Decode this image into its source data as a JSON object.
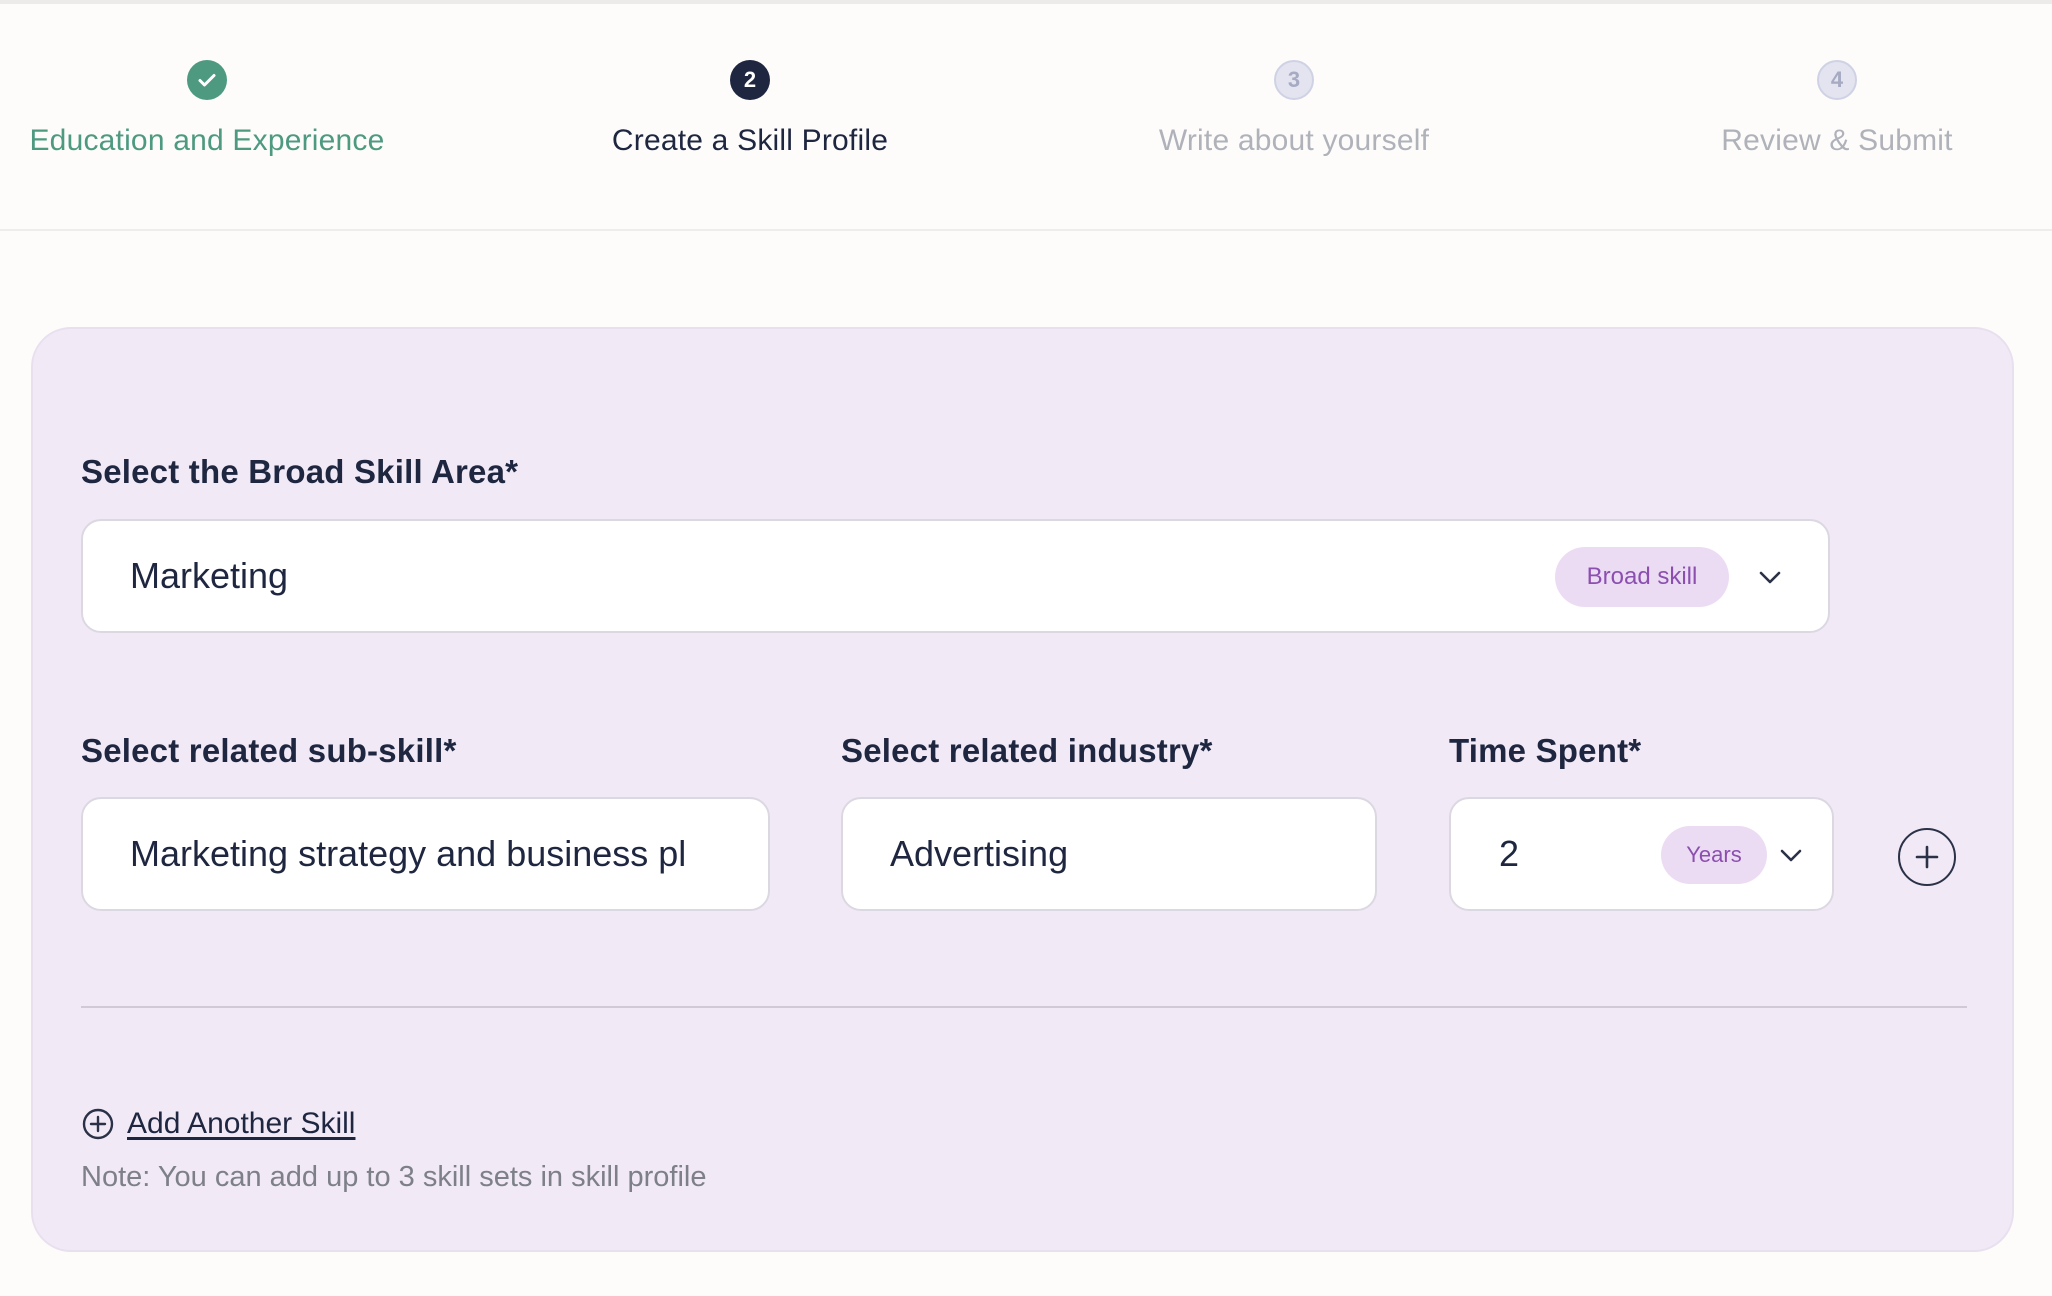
{
  "stepper": {
    "steps": [
      {
        "number": "1",
        "label": "Education and Experience",
        "state": "done",
        "icon": "check-icon"
      },
      {
        "number": "2",
        "label": "Create a Skill Profile",
        "state": "active"
      },
      {
        "number": "3",
        "label": "Write about yourself",
        "state": "todo"
      },
      {
        "number": "4",
        "label": "Review & Submit",
        "state": "todo"
      }
    ]
  },
  "form": {
    "broad_skill": {
      "label": "Select the Broad Skill Area*",
      "value": "Marketing",
      "tag": "Broad skill",
      "icon": "chevron-down-icon"
    },
    "sub_skill": {
      "label": "Select related sub-skill*",
      "value": "Marketing strategy and business pl"
    },
    "industry": {
      "label": "Select related industry*",
      "value": "Advertising"
    },
    "time_spent": {
      "label": "Time Spent*",
      "value": "2",
      "unit": "Years",
      "icon": "chevron-down-icon"
    },
    "add_row_icon": "plus-circle-icon"
  },
  "add_skill": {
    "label": "Add Another Skill",
    "icon": "plus-circle-icon"
  },
  "note": "Note: You can add up to 3 skill sets in skill profile",
  "colors": {
    "done": "#4e9a80",
    "active": "#1e2640",
    "todo": "#b0b2ba",
    "card_bg": "#f1e9f6",
    "pill_bg": "#ecdcf3",
    "pill_text": "#8b4fb0"
  }
}
